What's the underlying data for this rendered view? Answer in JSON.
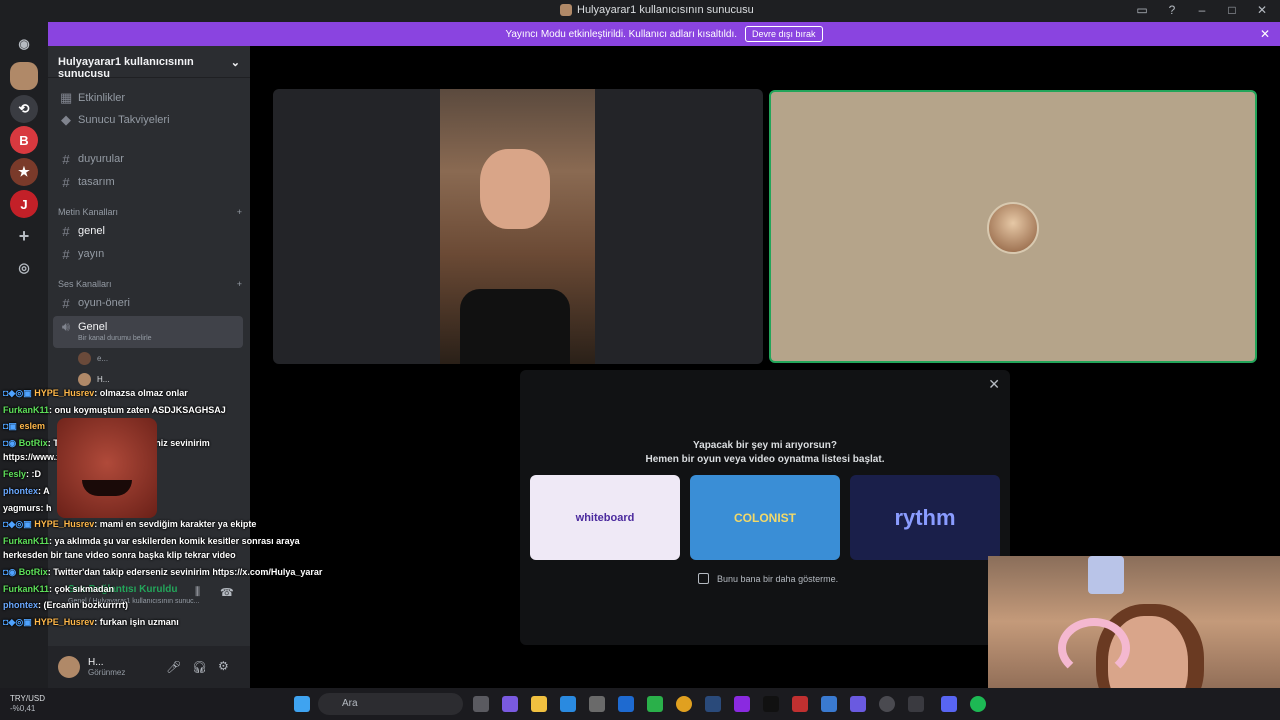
{
  "window": {
    "title": "Hulyayarar1 kullanıcısının sunucusu"
  },
  "banner": {
    "text": "Yayıncı Modu etkinleştirildi. Kullanıcı adları kısaltıldı.",
    "button": "Devre dışı bırak"
  },
  "server": {
    "name": "Hulyayarar1 kullanıcısının sunucusu",
    "top_items": [
      "Etkinlikler",
      "Sunucu Takviyeleri"
    ],
    "channels_top": [
      "duyurular",
      "tasarım"
    ],
    "text_category": "Metin Kanalları",
    "text_channels": [
      "genel",
      "yayın"
    ],
    "voice_category": "Ses Kanalları",
    "voice_channels": [
      "oyun-öneri",
      "Genel"
    ],
    "voice_status": "Bir kanal durumu belirle",
    "voice_users": [
      "e...",
      "H..."
    ]
  },
  "voice_connection": {
    "status": "Ses Bağlantısı Kuruldu",
    "sub": "Genel / Hulyayarar1 kullanıcısının sunuc..."
  },
  "user": {
    "name": "H...",
    "status": "Görünmez"
  },
  "activity_modal": {
    "title": "Yapacak bir şey mi arıyorsun?",
    "subtitle": "Hemen bir oyun veya video oynatma listesi başlat.",
    "cards": [
      "whiteboard",
      "COLONIST",
      "rythm"
    ],
    "checkbox": "Bunu bana bir daha gösterme."
  },
  "chat": [
    {
      "name": "HYPE_Husrev",
      "text": ": olmazsa olmaz onlar"
    },
    {
      "name": "FurkanK11",
      "text": ": onu koymuştum zaten ASDJKSAGHSAJ"
    },
    {
      "name": "eslem",
      "text": ""
    },
    {
      "name": "BotRix",
      "text": ": Twitter'dan takip ederseniz sevinirim"
    },
    {
      "name": "",
      "text": "https://www.x.com/Hulya_yarar/"
    },
    {
      "name": "Fesly",
      "text": ": :D"
    },
    {
      "name": "phontex",
      "text": ": A"
    },
    {
      "name": "yagmurs",
      "text": ": h"
    },
    {
      "name": "HYPE_Husrev",
      "text": ": mami en sevdiğim karakter ya ekipte"
    },
    {
      "name": "FurkanK11",
      "text": ": ya aklımda şu var eskilerden komik kesitler sonrası araya"
    },
    {
      "name": "",
      "text": "herkesden bir tane video sonra başka klip tekrar video"
    },
    {
      "name": "BotRix",
      "text": ": Twitter'dan takip ederseniz sevinirim https://x.com/Hulya_yarar"
    },
    {
      "name": "FurkanK11",
      "text": ": çok sıkmadan"
    },
    {
      "name": "phontex",
      "text": ": (Ercanın bozkurrrrt)"
    },
    {
      "name": "HYPE_Husrev",
      "text": ": furkan işin uzmanı"
    }
  ],
  "taskbar": {
    "ticker": "TRY/USD",
    "change": "-%0,41",
    "search": "Ara"
  }
}
